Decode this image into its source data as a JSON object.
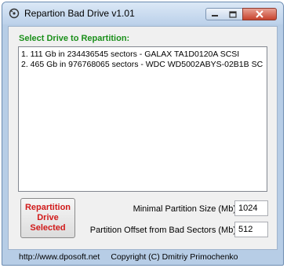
{
  "window": {
    "title": "Repartion Bad Drive v1.01"
  },
  "drive_section": {
    "label": "Select Drive to Repartition:",
    "drives": [
      "1. 111 Gb in 234436545 sectors  -  GALAX TA1D0120A SCSI",
      "2. 465 Gb in 976768065 sectors  -  WDC WD5002ABYS-02B1B SC"
    ]
  },
  "repartition_button": {
    "line1": "Repartition",
    "line2": "Drive",
    "line3": "Selected"
  },
  "settings": {
    "min_partition_label": "Minimal Partition Size (Mb)",
    "min_partition_value": "1024",
    "offset_label": "Partition Offset from Bad Sectors (Mb)",
    "offset_value": "512"
  },
  "status": {
    "url": "http://www.dposoft.net",
    "copyright": "Copyright (C) Dmitriy Primochenko"
  },
  "colors": {
    "section_label": "#1a8f1a",
    "button_text": "#d11a1a",
    "close_button": "#c7432d"
  }
}
